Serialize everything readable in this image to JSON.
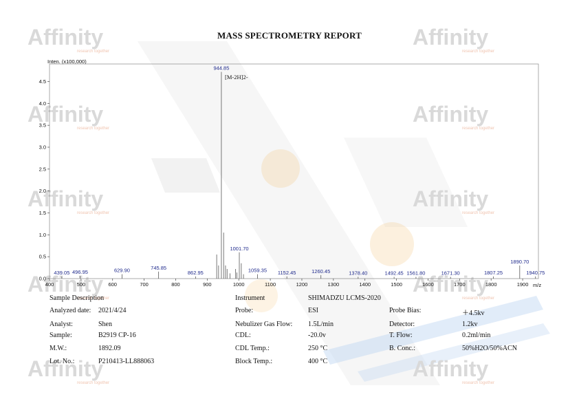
{
  "report_title": "MASS SPECTROMETRY REPORT",
  "watermark": {
    "logo_text": "Affinity",
    "tagline": "research together"
  },
  "colors": {
    "peak_label": "#1f2a8c",
    "watermark": "#d9d9d9",
    "accent_orange": "#f5c27a",
    "accent_blue": "#bcd4f2"
  },
  "chart_data": {
    "type": "line",
    "ylabel": "Inten. (x100,000)",
    "xlabel": "m/z",
    "xlim": [
      400,
      1950
    ],
    "ylim": [
      0,
      4.9
    ],
    "x_ticks": [
      "400",
      "500",
      "600",
      "700",
      "800",
      "900",
      "1000",
      "1100",
      "1200",
      "1300",
      "1400",
      "1500",
      "1600",
      "1700",
      "1800",
      "1900"
    ],
    "y_ticks": [
      "0.0",
      "0.5",
      "1.0",
      "1.5",
      "2.0",
      "2.5",
      "3.0",
      "3.5",
      "4.0",
      "4.5"
    ],
    "annotation": "[M-2H]2-",
    "peaks": [
      {
        "mz": 439.05,
        "intensity": 0.05,
        "label": "439.05"
      },
      {
        "mz": 496.95,
        "intensity": 0.06,
        "label": "496.95"
      },
      {
        "mz": 629.9,
        "intensity": 0.1,
        "label": "629.90"
      },
      {
        "mz": 745.85,
        "intensity": 0.16,
        "label": "745.85"
      },
      {
        "mz": 862.95,
        "intensity": 0.05,
        "label": "862.95"
      },
      {
        "mz": 944.85,
        "intensity": 4.72,
        "label": "944.85"
      },
      {
        "mz": 1001.7,
        "intensity": 0.6,
        "label": "1001.70"
      },
      {
        "mz": 1059.35,
        "intensity": 0.1,
        "label": "1059.35"
      },
      {
        "mz": 1152.45,
        "intensity": 0.05,
        "label": "1152.45"
      },
      {
        "mz": 1260.45,
        "intensity": 0.08,
        "label": "1260.45"
      },
      {
        "mz": 1378.4,
        "intensity": 0.04,
        "label": "1378.40"
      },
      {
        "mz": 1492.45,
        "intensity": 0.04,
        "label": "1492.45"
      },
      {
        "mz": 1561.8,
        "intensity": 0.04,
        "label": "1561.80"
      },
      {
        "mz": 1671.3,
        "intensity": 0.04,
        "label": "1671.30"
      },
      {
        "mz": 1807.25,
        "intensity": 0.05,
        "label": "1807.25"
      },
      {
        "mz": 1890.7,
        "intensity": 0.3,
        "label": "1890.70"
      },
      {
        "mz": 1940.75,
        "intensity": 0.05,
        "label": "1940.75"
      }
    ],
    "unlabeled_peaks": [
      {
        "mz": 930,
        "intensity": 0.55
      },
      {
        "mz": 936,
        "intensity": 0.3
      },
      {
        "mz": 952,
        "intensity": 1.05
      },
      {
        "mz": 958,
        "intensity": 0.3
      },
      {
        "mz": 963,
        "intensity": 0.22
      },
      {
        "mz": 972,
        "intensity": 0.12
      },
      {
        "mz": 990,
        "intensity": 0.22
      },
      {
        "mz": 994,
        "intensity": 0.14
      },
      {
        "mz": 1008,
        "intensity": 0.35
      },
      {
        "mz": 1015,
        "intensity": 0.1
      }
    ]
  },
  "info": {
    "sample_description_label": "Sample Description",
    "instrument_label": "Instrument",
    "instrument_value": "SHIMADZU LCMS-2020",
    "analyzed_date_label": "Analyzed date:",
    "analyzed_date_value": "2021/4/24",
    "probe_label": "Probe:",
    "probe_value": "ESI",
    "probe_bias_label": "Probe Bias:",
    "probe_bias_value": "＋4.5kv",
    "analyst_label": "Analyst:",
    "analyst_value": "Shen",
    "nebulizer_label": "Nebulizer Gas Flow:",
    "nebulizer_value": "1.5L/min",
    "detector_label": "Detector:",
    "detector_value": "1.2kv",
    "sample_label": "Sample:",
    "sample_value": "B2919 CP-16",
    "cdl_label": "CDL:",
    "cdl_value": "-20.0v",
    "tflow_label": "T. Flow:",
    "tflow_value": "0.2ml/min",
    "mw_label": "M.W.:",
    "mw_value": "1892.09",
    "cdl_temp_label": "CDL Temp.:",
    "cdl_temp_value": "250 °C",
    "bconc_label": "B. Conc.:",
    "bconc_value": "50%H2O/50%ACN",
    "lot_label": "Lot. No.:",
    "lot_value": "P210413-LL888063",
    "block_temp_label": "Block Temp.:",
    "block_temp_value": "400 °C"
  }
}
